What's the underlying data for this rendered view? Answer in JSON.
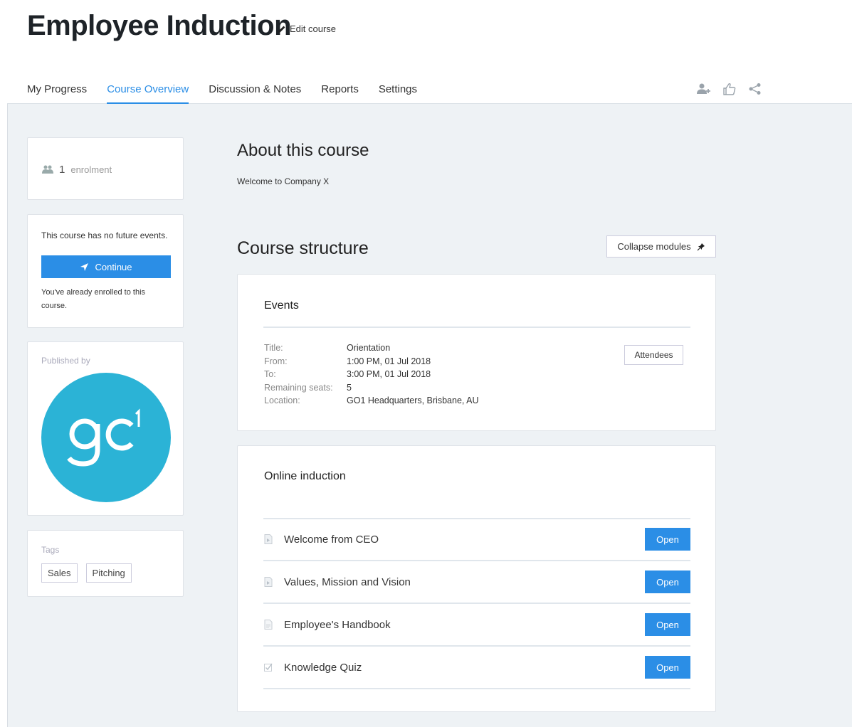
{
  "header": {
    "title": "Employee Induction",
    "edit_label": "Edit course",
    "tabs": [
      {
        "label": "My Progress",
        "active": false
      },
      {
        "label": "Course Overview",
        "active": true
      },
      {
        "label": "Discussion & Notes",
        "active": false
      },
      {
        "label": "Reports",
        "active": false
      },
      {
        "label": "Settings",
        "active": false
      }
    ],
    "icons": [
      "add-user-icon",
      "thumbs-up-icon",
      "share-icon"
    ]
  },
  "sidebar": {
    "enrolment_count": "1",
    "enrolment_label": "enrolment",
    "no_events_text": "This course has no future events.",
    "continue_label": "Continue",
    "enrolled_text": "You've already enrolled to this course.",
    "published_by_label": "Published by",
    "publisher_logo_text": "go1",
    "tags_label": "Tags",
    "tags": [
      "Sales",
      "Pitching"
    ]
  },
  "main": {
    "about_title": "About this course",
    "about_text": "Welcome to Company X",
    "structure_title": "Course structure",
    "collapse_label": "Collapse modules",
    "events": {
      "title": "Events",
      "rows": [
        {
          "key": "Title:",
          "value": "Orientation"
        },
        {
          "key": "From:",
          "value": "1:00 PM, 01 Jul 2018"
        },
        {
          "key": "To:",
          "value": "3:00 PM, 01 Jul 2018"
        },
        {
          "key": "Remaining seats:",
          "value": "5"
        },
        {
          "key": "Location:",
          "value": "GO1 Headquarters, Brisbane, AU"
        }
      ],
      "attendees_label": "Attendees"
    },
    "online": {
      "title": "Online induction",
      "modules": [
        {
          "label": "Welcome from CEO",
          "icon": "video-file-icon",
          "button": "Open"
        },
        {
          "label": "Values, Mission and Vision",
          "icon": "video-file-icon",
          "button": "Open"
        },
        {
          "label": "Employee's Handbook",
          "icon": "document-icon",
          "button": "Open"
        },
        {
          "label": "Knowledge Quiz",
          "icon": "quiz-check-icon",
          "button": "Open"
        }
      ]
    }
  },
  "colors": {
    "accent": "#2b8ee6",
    "logo": "#2bb3d6",
    "background": "#eef2f5"
  }
}
